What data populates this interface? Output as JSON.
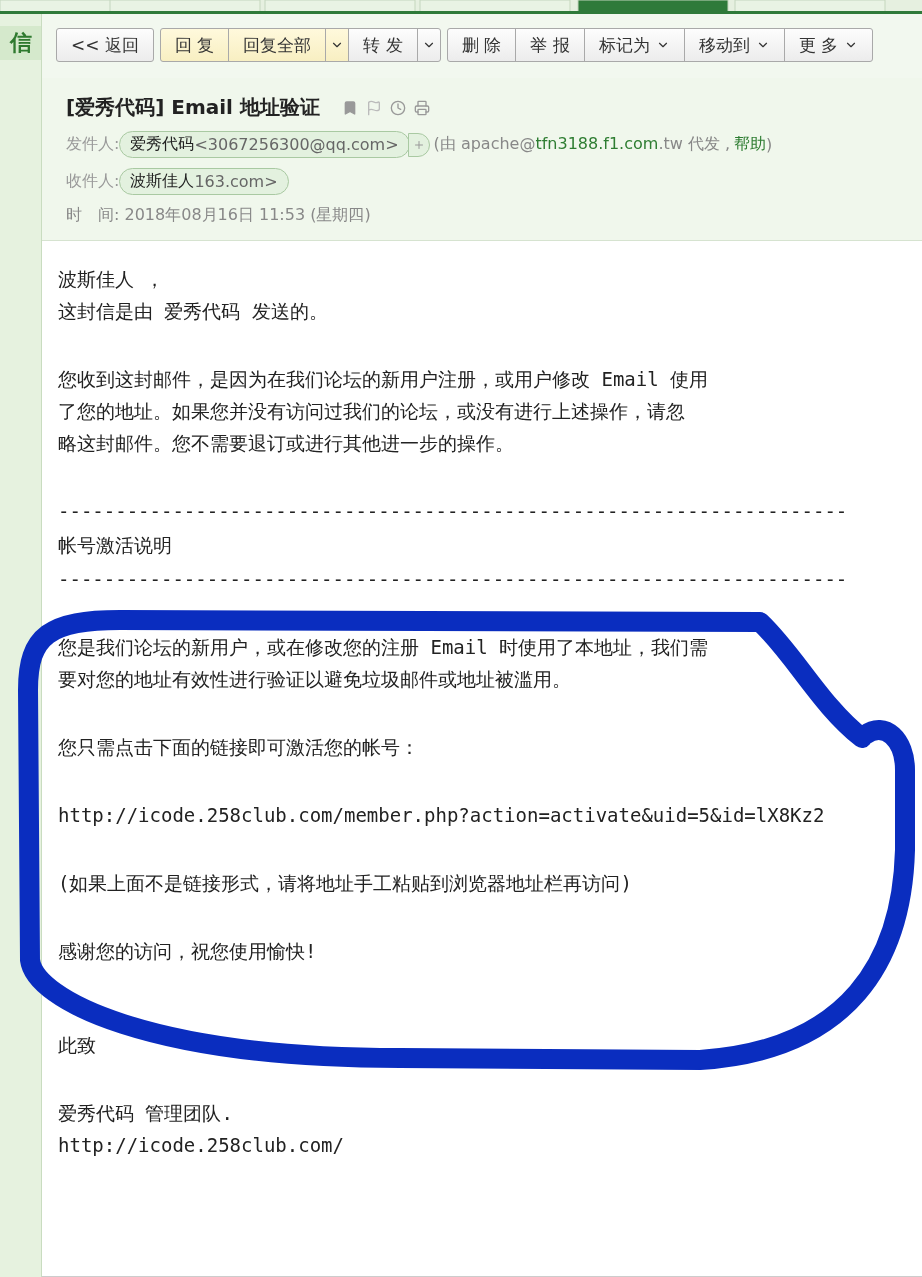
{
  "sidebar": {
    "label": "信"
  },
  "toolbar": {
    "groups": [
      [
        {
          "kind": "button",
          "label": "<< 返回",
          "highlighted": false,
          "menu": false
        }
      ],
      [
        {
          "kind": "button",
          "label": "回 复",
          "highlighted": true,
          "menu": false
        },
        {
          "kind": "button",
          "label": "回复全部",
          "highlighted": true,
          "menu": false
        },
        {
          "kind": "caret",
          "highlighted": true
        },
        {
          "kind": "button",
          "label": "转 发",
          "highlighted": false,
          "menu": false
        },
        {
          "kind": "caret",
          "highlighted": false
        }
      ],
      [
        {
          "kind": "button",
          "label": "删 除",
          "highlighted": false,
          "menu": false
        },
        {
          "kind": "button",
          "label": "举 报",
          "highlighted": false,
          "menu": false
        },
        {
          "kind": "button",
          "label": "标记为",
          "highlighted": false,
          "menu": true
        },
        {
          "kind": "button",
          "label": "移动到",
          "highlighted": false,
          "menu": true
        },
        {
          "kind": "button",
          "label": "更 多",
          "highlighted": false,
          "menu": true
        }
      ]
    ]
  },
  "mail": {
    "subject": "[爱秀代码] Email 地址验证",
    "from": {
      "label": "发件人:",
      "name": "爱秀代码",
      "address": "<3067256300@qq.com>",
      "via_open": "(由 apache@",
      "via_domain": "tfn3188.f1.com",
      "via_rest": ".tw 代发 ,",
      "help": "帮助",
      "via_close": ")"
    },
    "to": {
      "label": "收件人:",
      "name": "波斯佳人",
      "address": "163.com>"
    },
    "time": "时　间: 2018年08月16日 11:53 (星期四)"
  },
  "body": [
    {
      "kind": "text",
      "lines": [
        "波斯佳人 ，",
        "这封信是由 爱秀代码 发送的。"
      ]
    },
    {
      "kind": "text",
      "lines": [
        "您收到这封邮件，是因为在我们论坛的新用户注册，或用户修改 Email 使用",
        "了您的地址。如果您并没有访问过我们的论坛，或没有进行上述操作，请忽",
        "略这封邮件。您不需要退订或进行其他进一步的操作。"
      ]
    },
    {
      "kind": "rule",
      "lines": [
        "---------------------------------------------------------------------"
      ]
    },
    {
      "kind": "heading",
      "lines": [
        "帐号激活说明"
      ]
    },
    {
      "kind": "heading-rule",
      "lines": [
        "---------------------------------------------------------------------"
      ]
    },
    {
      "kind": "text",
      "lines": [
        "您是我们论坛的新用户，或在修改您的注册 Email 时使用了本地址，我们需",
        "要对您的地址有效性进行验证以避免垃圾邮件或地址被滥用。"
      ]
    },
    {
      "kind": "text",
      "lines": [
        "您只需点击下面的链接即可激活您的帐号："
      ]
    },
    {
      "kind": "link",
      "lines": [
        "http://icode.258club.com/member.php?action=activate&uid=5&id=lX8Kz2"
      ]
    },
    {
      "kind": "text",
      "lines": [
        "(如果上面不是链接形式，请将地址手工粘贴到浏览器地址栏再访问)"
      ]
    },
    {
      "kind": "text",
      "lines": [
        "感谢您的访问，祝您使用愉快!"
      ]
    },
    {
      "kind": "signature",
      "lines": [
        "此致"
      ]
    },
    {
      "kind": "text",
      "lines": [
        "爱秀代码 管理团队.",
        "http://icode.258club.com/"
      ]
    }
  ]
}
